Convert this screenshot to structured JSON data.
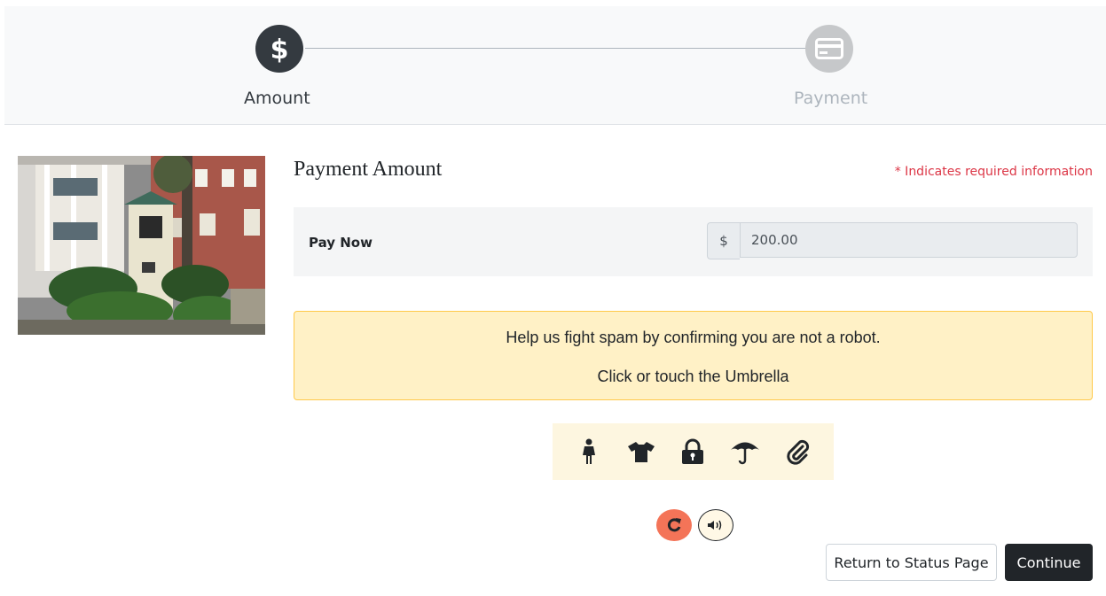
{
  "stepper": {
    "steps": [
      {
        "label": "Amount",
        "icon": "dollar-icon",
        "state": "active"
      },
      {
        "label": "Payment",
        "icon": "credit-card-icon",
        "state": "inactive"
      }
    ]
  },
  "form": {
    "title": "Payment Amount",
    "required_note": "* Indicates required information",
    "pay_now_label": "Pay Now",
    "currency_symbol": "$",
    "amount_value": "200.00"
  },
  "captcha": {
    "instruction": "Help us fight spam by confirming you are not a robot.",
    "prompt": "Click or touch the Umbrella",
    "icons": [
      "person-icon",
      "tshirt-icon",
      "lock-icon",
      "umbrella-icon",
      "paperclip-icon"
    ]
  },
  "actions": {
    "return_label": "Return to Status Page",
    "continue_label": "Continue"
  },
  "colors": {
    "accent_dark": "#212529",
    "required_red": "#dc3545",
    "alert_bg": "#fff1c6",
    "refresh_orange": "#f47458"
  }
}
